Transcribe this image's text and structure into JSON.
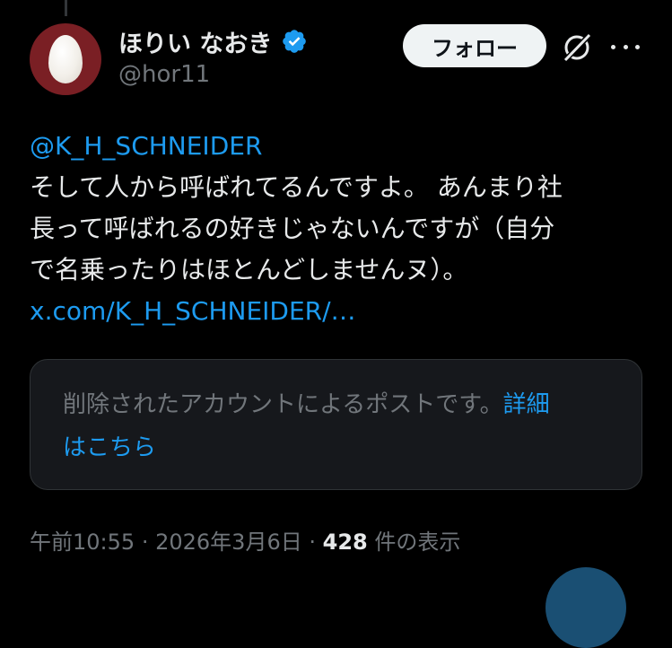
{
  "author": {
    "display_name": "ほりい なおき",
    "handle": "@hor11",
    "verified": true
  },
  "actions": {
    "follow_label": "フォロー"
  },
  "post": {
    "mention": "@K_H_SCHNEIDER",
    "lines": [
      "そして人から呼ばれてるんですよ。 あんまり社",
      "長って呼ばれるの好きじゃないんですが（自分",
      "で名乗ったりはほとんどしませんヌ）。"
    ],
    "link": "x.com/K_H_SCHNEIDER/…"
  },
  "quote": {
    "text": "削除されたアカウントによるポストです。",
    "details_line1": "詳細",
    "details_line2": "はこちら"
  },
  "meta": {
    "time": "午前10:55",
    "date": "2026年3月6日",
    "separator": "·",
    "view_count": "428",
    "view_label": "件の表示"
  },
  "colors": {
    "background": "#000000",
    "accent": "#1d9bf0",
    "text": "#e7e9ea",
    "muted": "#71767b",
    "avatar_bg": "#7a1f24"
  },
  "icons": {
    "verified": "verified-badge-icon",
    "grok": "grok-icon",
    "more": "more-icon"
  }
}
